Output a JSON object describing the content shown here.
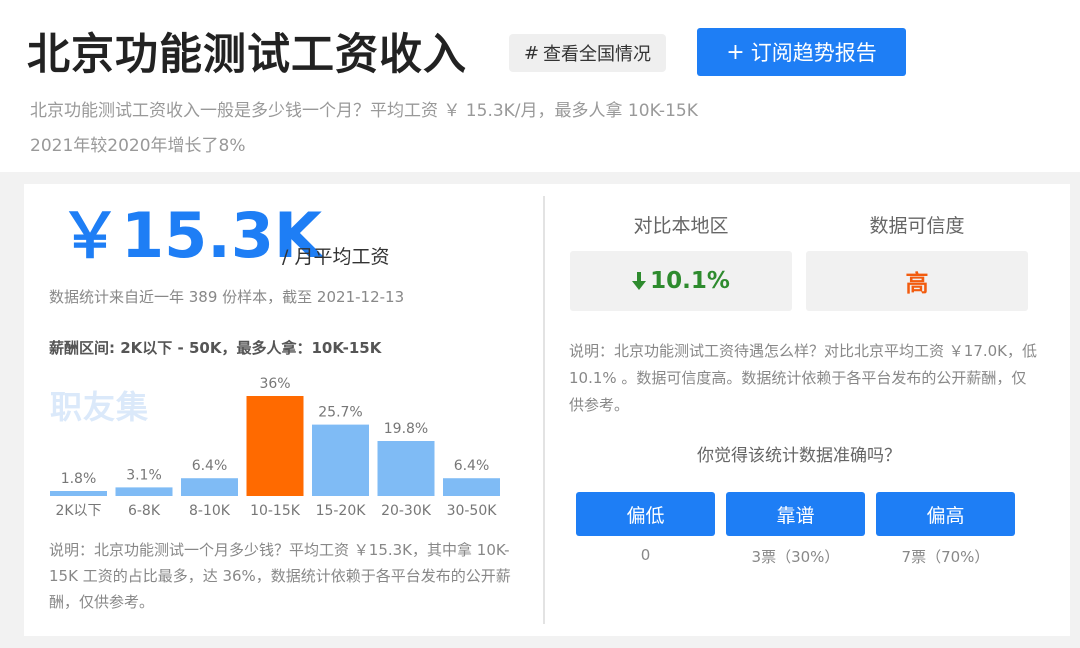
{
  "header": {
    "title": "北京功能测试工资收入",
    "tag_button": "查看全国情况",
    "tag_hash": "#",
    "subscribe_plus": "+",
    "subscribe_button": "订阅趋势报告",
    "description_line1": "北京功能测试工资收入一般是多少钱一个月？平均工资 ￥ 15.3K/月，最多人拿 10K-15K",
    "description_line2": "2021年较2020年增长了8%"
  },
  "salary": {
    "value": "￥15.3K",
    "unit": "/ 月平均工资",
    "sample_info": "数据统计来自近一年 389 份样本，截至 2021-12-13",
    "range_info": "薪酬区间: 2K以下 - 50K，最多人拿：10K-15K",
    "watermark": "职友集",
    "note": "说明：北京功能测试一个月多少钱？平均工资 ￥15.3K，其中拿 10K-15K 工资的占比最多，达 36%，数据统计依赖于各平台发布的公开薪酬，仅供参考。"
  },
  "chart_data": {
    "type": "bar",
    "categories": [
      "2K以下",
      "6-8K",
      "8-10K",
      "10-15K",
      "15-20K",
      "20-30K",
      "30-50K"
    ],
    "values": [
      1.8,
      3.1,
      6.4,
      36,
      25.7,
      19.8,
      6.4
    ],
    "value_labels": [
      "1.8%",
      "3.1%",
      "6.4%",
      "36%",
      "25.7%",
      "19.8%",
      "6.4%"
    ],
    "highlight_index": 3,
    "ylim": [
      0,
      36
    ],
    "colors": {
      "normal": "#7fbbf5",
      "highlight": "#ff6a00"
    }
  },
  "comparison": {
    "region_label": "对比本地区",
    "region_value": "10.1%",
    "region_direction_icon": "arrow-down-icon",
    "credibility_label": "数据可信度",
    "credibility_value": "高",
    "note": "说明：北京功能测试工资待遇怎么样？对比北京平均工资 ￥17.0K，低 10.1% 。数据可信度高。数据统计依赖于各平台发布的公开薪酬，仅供参考。"
  },
  "feedback": {
    "question": "你觉得该统计数据准确吗？",
    "buttons": [
      {
        "label": "偏低",
        "count": "0"
      },
      {
        "label": "靠谱",
        "count": "3票（30%）"
      },
      {
        "label": "偏高",
        "count": "7票（70%）"
      }
    ]
  },
  "colors": {
    "accent": "#1e7ef5",
    "highlight": "#ff6a00",
    "down": "#2e8b2e",
    "credibility": "#f25c0f"
  }
}
